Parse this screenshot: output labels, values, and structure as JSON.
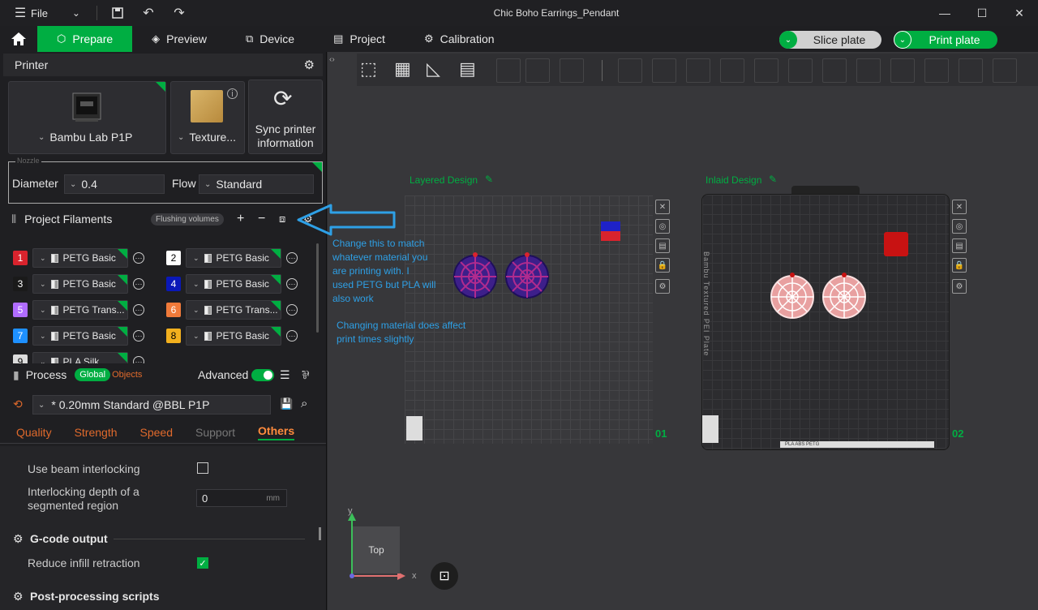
{
  "window": {
    "menu_label": "File",
    "title": "Chic Boho Earrings_Pendant"
  },
  "tabs": [
    {
      "label": "Prepare"
    },
    {
      "label": "Preview"
    },
    {
      "label": "Device"
    },
    {
      "label": "Project"
    },
    {
      "label": "Calibration"
    }
  ],
  "actions": {
    "slice_label": "Slice plate",
    "print_label": "Print plate"
  },
  "printer": {
    "section_title": "Printer",
    "model": "Bambu Lab P1P",
    "plate": "Texture...",
    "sync_line1": "Sync printer",
    "sync_line2": "information",
    "nozzle_legend": "Nozzle",
    "diameter_label": "Diameter",
    "diameter_value": "0.4",
    "flow_label": "Flow",
    "flow_value": "Standard"
  },
  "filaments": {
    "section_title": "Project Filaments",
    "flushing_label": "Flushing volumes",
    "items": [
      {
        "num": "1",
        "color": "#d9232d",
        "name": "PETG Basic"
      },
      {
        "num": "2",
        "color": "#ffffff",
        "name": "PETG Basic"
      },
      {
        "num": "3",
        "color": "#1a1a1a",
        "name": "PETG Basic"
      },
      {
        "num": "4",
        "color": "#0a18b8",
        "name": "PETG Basic"
      },
      {
        "num": "5",
        "color": "#b06cff",
        "name": "PETG Trans..."
      },
      {
        "num": "6",
        "color": "#f07a3a",
        "name": "PETG Trans..."
      },
      {
        "num": "7",
        "color": "#1e90ff",
        "name": "PETG Basic"
      },
      {
        "num": "8",
        "color": "#f2b01e",
        "name": "PETG Basic"
      },
      {
        "num": "9",
        "color": "#dcdcdc",
        "name": "PLA Silk"
      }
    ]
  },
  "process": {
    "section_title": "Process",
    "global_label": "Global",
    "objects_label": "Objects",
    "advanced_label": "Advanced",
    "advanced_on": true,
    "profile": "* 0.20mm Standard @BBL P1P",
    "subtabs": [
      "Quality",
      "Strength",
      "Speed",
      "Support",
      "Others"
    ],
    "beam_label": "Use beam interlocking",
    "beam_checked": false,
    "depth_label_1": "Interlocking depth of a",
    "depth_label_2": "segmented region",
    "depth_value": "0",
    "depth_unit": "mm",
    "gcode_title": "G-code output",
    "reduce_label": "Reduce infill retraction",
    "reduce_checked": true,
    "post_title": "Post-processing scripts"
  },
  "viewport": {
    "plate1_title": "Layered Design",
    "plate1_num": "01",
    "plate2_title": "Inlaid Design",
    "plate2_num": "02",
    "plate2_vertical": "Bambu Textured PEI Plate",
    "plate2_strip": "PLA ABS PETG",
    "annotation_1": [
      "Change this to match",
      "whatever material you",
      "are printing with. I",
      "used PETG but PLA will",
      "also work"
    ],
    "annotation_2": [
      "Changing material does affect",
      "print times slightly"
    ],
    "axis_y": "y",
    "axis_x": "x",
    "view_label": "Top"
  },
  "colors": {
    "accent": "#00ae42",
    "annotation": "#2ea0e6",
    "tab_orange": "#e06a2c"
  }
}
